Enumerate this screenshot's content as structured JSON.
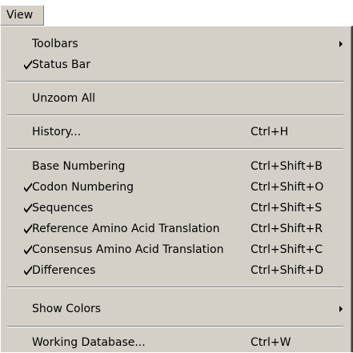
{
  "menubar": {
    "view_label": "View"
  },
  "menu": {
    "items": [
      {
        "label": "Toolbars",
        "shortcut": "",
        "checked": false,
        "submenu": true
      },
      {
        "label": "Status Bar",
        "shortcut": "",
        "checked": true,
        "submenu": false
      },
      {
        "label": "Unzoom All",
        "shortcut": "",
        "checked": false,
        "submenu": false
      },
      {
        "label": "History...",
        "shortcut": "Ctrl+H",
        "checked": false,
        "submenu": false
      },
      {
        "label": "Base Numbering",
        "shortcut": "Ctrl+Shift+B",
        "checked": false,
        "submenu": false
      },
      {
        "label": "Codon Numbering",
        "shortcut": "Ctrl+Shift+O",
        "checked": true,
        "submenu": false
      },
      {
        "label": "Sequences",
        "shortcut": "Ctrl+Shift+S",
        "checked": true,
        "submenu": false
      },
      {
        "label": "Reference Amino Acid Translation",
        "shortcut": "Ctrl+Shift+R",
        "checked": true,
        "submenu": false
      },
      {
        "label": "Consensus Amino Acid Translation",
        "shortcut": "Ctrl+Shift+C",
        "checked": true,
        "submenu": false
      },
      {
        "label": "Differences",
        "shortcut": "Ctrl+Shift+D",
        "checked": true,
        "submenu": false
      },
      {
        "label": "Show Colors",
        "shortcut": "",
        "checked": false,
        "submenu": true
      },
      {
        "label": "Working Database...",
        "shortcut": "Ctrl+W",
        "checked": false,
        "submenu": false
      }
    ]
  }
}
